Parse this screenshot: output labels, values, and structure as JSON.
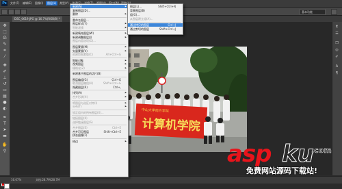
{
  "app": {
    "logo_text": "Ps"
  },
  "menubar": {
    "items": [
      "文件(F)",
      "编辑(E)",
      "图像(I)",
      "图层(L)",
      "类型(Y)",
      "选择(S)",
      "滤镜(T)",
      "视图(V)",
      "窗口(W)",
      "帮助(H)"
    ],
    "active_index": 3
  },
  "options_bar": {
    "workspace": "基本功能"
  },
  "document_tab": {
    "title": "DSC_0619.JPG @ 16.7%(RGB/8) *"
  },
  "status_bar": {
    "zoom": "16.67%",
    "doc_size": "文档:28.7M/28.7M"
  },
  "layer_menu": {
    "items": [
      {
        "label": "新建(N)",
        "shortcut": "",
        "submenu": true,
        "state": "highlight"
      },
      {
        "label": "复制图层(D)...",
        "shortcut": "",
        "submenu": false,
        "state": "normal"
      },
      {
        "label": "删除",
        "shortcut": "",
        "submenu": true,
        "state": "normal"
      },
      {
        "separator": true
      },
      {
        "label": "重命名图层...",
        "shortcut": "",
        "submenu": false,
        "state": "normal"
      },
      {
        "label": "图层样式(Y)",
        "shortcut": "",
        "submenu": true,
        "state": "normal"
      },
      {
        "label": "智能滤镜",
        "shortcut": "",
        "submenu": true,
        "state": "disabled"
      },
      {
        "separator": true
      },
      {
        "label": "新建填充图层(W)",
        "shortcut": "",
        "submenu": true,
        "state": "normal"
      },
      {
        "label": "新建调整图层(J)",
        "shortcut": "",
        "submenu": true,
        "state": "normal"
      },
      {
        "label": "图层内容选项(O)...",
        "shortcut": "",
        "submenu": false,
        "state": "disabled"
      },
      {
        "separator": true
      },
      {
        "label": "图层蒙版(M)",
        "shortcut": "",
        "submenu": true,
        "state": "normal"
      },
      {
        "label": "矢量蒙版(V)",
        "shortcut": "",
        "submenu": true,
        "state": "normal"
      },
      {
        "label": "创建剪贴蒙版(C)",
        "shortcut": "Alt+Ctrl+G",
        "submenu": false,
        "state": "disabled"
      },
      {
        "separator": true
      },
      {
        "label": "智能对象",
        "shortcut": "",
        "submenu": true,
        "state": "normal"
      },
      {
        "label": "视频图层",
        "shortcut": "",
        "submenu": true,
        "state": "normal"
      },
      {
        "label": "栅格化(Z)",
        "shortcut": "",
        "submenu": true,
        "state": "disabled"
      },
      {
        "separator": true
      },
      {
        "label": "新建基于图层的切片(B)",
        "shortcut": "",
        "submenu": false,
        "state": "normal"
      },
      {
        "separator": true
      },
      {
        "label": "图层编组(G)",
        "shortcut": "Ctrl+G",
        "submenu": false,
        "state": "normal"
      },
      {
        "label": "取消图层编组(U)",
        "shortcut": "Shift+Ctrl+G",
        "submenu": false,
        "state": "disabled"
      },
      {
        "label": "隐藏图层(R)",
        "shortcut": "Ctrl+,",
        "submenu": false,
        "state": "normal"
      },
      {
        "separator": true
      },
      {
        "label": "排列(A)",
        "shortcut": "",
        "submenu": true,
        "state": "normal"
      },
      {
        "label": "合并形状(H)",
        "shortcut": "",
        "submenu": true,
        "state": "disabled"
      },
      {
        "separator": true
      },
      {
        "label": "将图层与选区对齐(I)",
        "shortcut": "",
        "submenu": true,
        "state": "disabled"
      },
      {
        "label": "分布(T)",
        "shortcut": "",
        "submenu": true,
        "state": "disabled"
      },
      {
        "separator": true
      },
      {
        "label": "锁定组内的所有图层(X)...",
        "shortcut": "",
        "submenu": false,
        "state": "disabled"
      },
      {
        "separator": true
      },
      {
        "label": "链接图层(K)",
        "shortcut": "",
        "submenu": false,
        "state": "disabled"
      },
      {
        "label": "选择链接图层(S)",
        "shortcut": "",
        "submenu": false,
        "state": "disabled"
      },
      {
        "separator": true
      },
      {
        "label": "合并图层(E)",
        "shortcut": "Ctrl+E",
        "submenu": false,
        "state": "disabled"
      },
      {
        "label": "合并可见图层",
        "shortcut": "Shift+Ctrl+E",
        "submenu": false,
        "state": "normal"
      },
      {
        "label": "拼合图像(F)",
        "shortcut": "",
        "submenu": false,
        "state": "normal"
      },
      {
        "separator": true
      },
      {
        "label": "修边",
        "shortcut": "",
        "submenu": true,
        "state": "normal"
      }
    ]
  },
  "new_submenu": {
    "items": [
      {
        "label": "图层(L)...",
        "shortcut": "Shift+Ctrl+N",
        "state": "normal"
      },
      {
        "label": "背景图层(B)",
        "shortcut": "",
        "state": "normal"
      },
      {
        "label": "组(G)...",
        "shortcut": "",
        "state": "normal"
      },
      {
        "label": "从图层建立组(A)...",
        "shortcut": "",
        "state": "disabled"
      },
      {
        "separator": true
      },
      {
        "label": "通过拷贝的图层",
        "shortcut": "Ctrl+J",
        "state": "highlight"
      },
      {
        "label": "通过剪切的图层",
        "shortcut": "Shift+Ctrl+J",
        "state": "normal"
      }
    ]
  },
  "photo": {
    "banner_text": "计算机学院",
    "banner_small_text": "中山大学南方学院"
  },
  "watermark": {
    "brand_red": "asp",
    "brand_dark": "ku",
    "tld": ".com",
    "tagline": "免费网站源码下载站!"
  },
  "colors": {
    "foreground": "#e00000",
    "background": "#ffffff",
    "menu_highlight": "#3d86d9"
  }
}
